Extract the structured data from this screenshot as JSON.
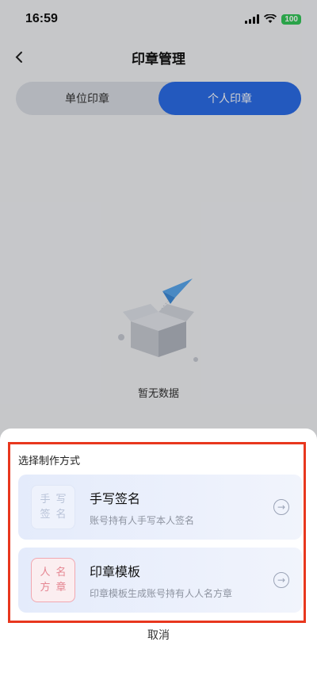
{
  "status": {
    "time": "16:59",
    "battery": "100"
  },
  "nav": {
    "title": "印章管理"
  },
  "segments": [
    {
      "label": "单位印章",
      "active": false
    },
    {
      "label": "个人印章",
      "active": true
    }
  ],
  "empty": {
    "text": "暂无数据"
  },
  "sheet": {
    "title": "选择制作方式",
    "options": [
      {
        "title": "手写签名",
        "desc": "账号持有人手写本人签名",
        "icon_chars": [
          "手",
          "写",
          "签",
          "名"
        ],
        "icon": "handwriting-icon"
      },
      {
        "title": "印章模板",
        "desc": "印章模板生成账号持有人人名方章",
        "icon_chars": [
          "人",
          "名",
          "方",
          "章"
        ],
        "icon": "seal-icon"
      }
    ],
    "cancel": "取消"
  },
  "colors": {
    "accent": "#2b6de8",
    "highlight_frame": "#e8371e",
    "seal_red": "#e58591"
  }
}
